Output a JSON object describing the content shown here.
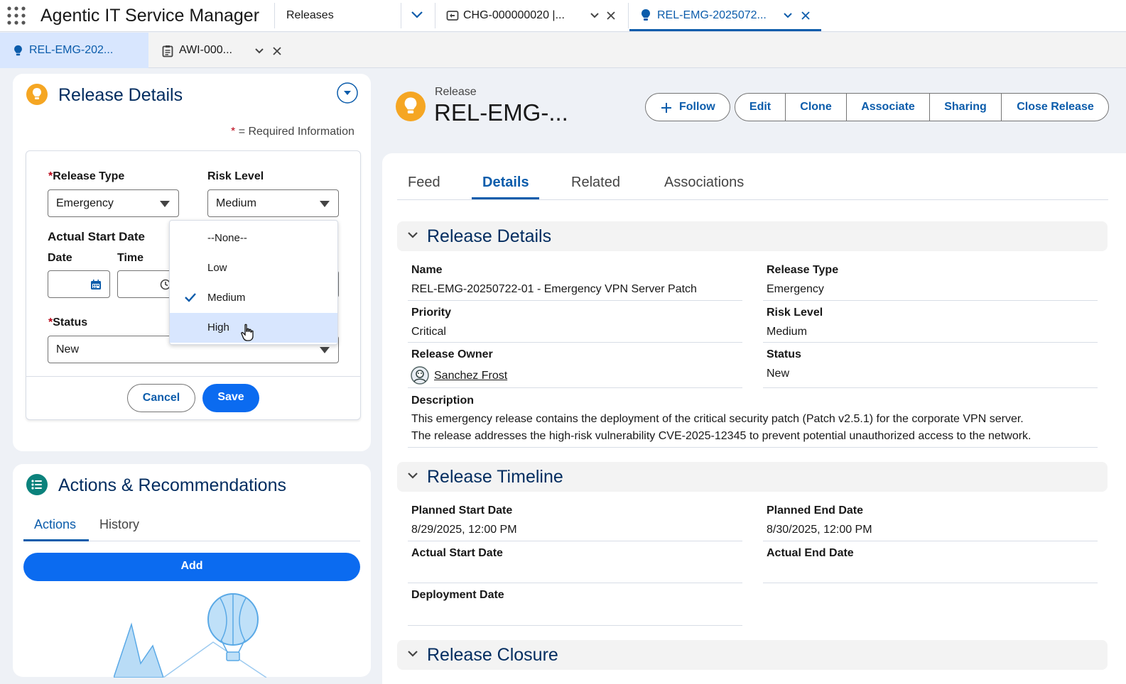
{
  "app": {
    "title": "Agentic IT Service Manager",
    "nav_label": "Releases"
  },
  "tabs": [
    {
      "label": "CHG-000000020 |..."
    },
    {
      "label": "REL-EMG-2025072..."
    }
  ],
  "subtabs": [
    {
      "label": "REL-EMG-202..."
    },
    {
      "label": "AWI-000..."
    }
  ],
  "form": {
    "title": "Release Details",
    "required_note": "= Required Information",
    "required_star": "*",
    "release_type": {
      "label": "Release Type",
      "value": "Emergency"
    },
    "risk_level": {
      "label": "Risk Level",
      "value": "Medium"
    },
    "actual_start": {
      "label": "Actual Start Date",
      "date_label": "Date",
      "time_label": "Time"
    },
    "status": {
      "label": "Status",
      "value": "New"
    },
    "cancel": "Cancel",
    "save": "Save"
  },
  "dropdown": {
    "options": [
      "--None--",
      "Low",
      "Medium",
      "High"
    ],
    "selected": "Medium",
    "hovered": "High"
  },
  "actions_panel": {
    "title": "Actions & Recommendations",
    "tabs": [
      "Actions",
      "History"
    ],
    "add": "Add"
  },
  "record": {
    "object_label": "Release",
    "title": "REL-EMG-...",
    "buttons": {
      "follow": "Follow",
      "edit": "Edit",
      "clone": "Clone",
      "associate": "Associate",
      "sharing": "Sharing",
      "close": "Close Release"
    },
    "tabs": [
      "Feed",
      "Details",
      "Related",
      "Associations"
    ],
    "active_tab": "Details"
  },
  "details": {
    "section1": "Release Details",
    "name_label": "Name",
    "name_value": "REL-EMG-20250722-01 - Emergency VPN Server Patch",
    "release_type_label": "Release Type",
    "release_type_value": "Emergency",
    "priority_label": "Priority",
    "priority_value": "Critical",
    "risk_label": "Risk Level",
    "risk_value": "Medium",
    "owner_label": "Release Owner",
    "owner_value": "Sanchez Frost",
    "status_label": "Status",
    "status_value": "New",
    "description_label": "Description",
    "description_line1": "This emergency release contains the deployment of the critical security patch (Patch v2.5.1) for the corporate VPN server.",
    "description_line2": "The release addresses the high-risk vulnerability CVE-2025-12345 to prevent potential unauthorized access to the network.",
    "section2": "Release Timeline",
    "planned_start_label": "Planned Start Date",
    "planned_start_value": "8/29/2025, 12:00 PM",
    "planned_end_label": "Planned End Date",
    "planned_end_value": "8/30/2025, 12:00 PM",
    "actual_start_label": "Actual Start Date",
    "actual_end_label": "Actual End Date",
    "deployment_label": "Deployment Date",
    "section3": "Release Closure"
  },
  "colors": {
    "brand": "#0b6bf0",
    "link": "#0b5cab",
    "heading": "#032d60",
    "icon_orange": "#f5a623"
  }
}
